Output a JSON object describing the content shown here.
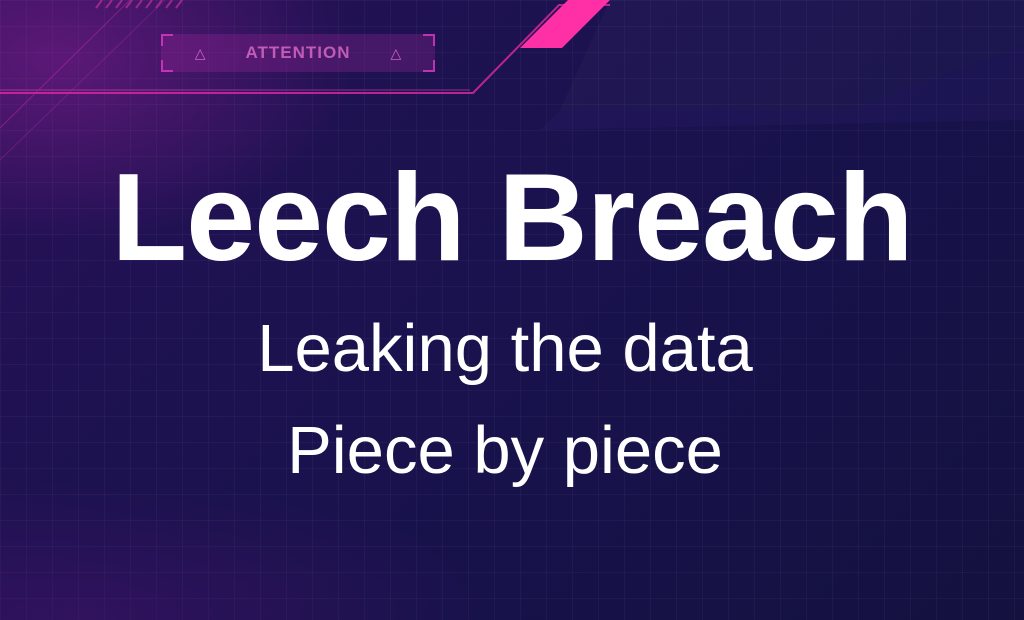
{
  "banner": {
    "label": "ATTENTION",
    "left_icon": "warning-triangle-icon",
    "right_icon": "warning-triangle-icon"
  },
  "headline": {
    "title": "Leech Breach",
    "line1": "Leaking the data",
    "line2": "Piece by piece"
  },
  "colors": {
    "background": "#1b1250",
    "accent": "#e0249a",
    "text": "#ffffff"
  }
}
